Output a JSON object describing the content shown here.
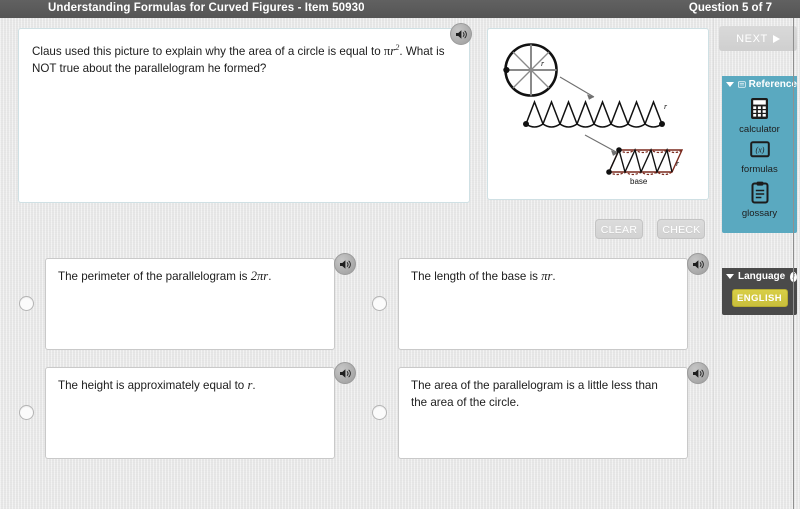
{
  "header": {
    "title": "Understanding Formulas for Curved Figures - Item 50930",
    "question_number": "Question 5 of 7"
  },
  "stem": {
    "text_before": "Claus used this picture to explain why the area of a circle is equal to ",
    "math_pi": "π",
    "math_r": "r",
    "math_exponent": "2",
    "text_after": ". What is NOT true about the parallelogram he formed?",
    "speaker_icon": "speaker-icon"
  },
  "figure": {
    "label_r_circle": "r",
    "label_r_strip": "r",
    "label_r_parallelogram": "r",
    "label_base": "base",
    "sector_count": 8,
    "outline_color": "#111111",
    "parallelogram_color": "#7a2a1e"
  },
  "actions": {
    "clear_label": "CLEAR",
    "check_label": "CHECK"
  },
  "options": [
    {
      "id": "option-a",
      "segments": [
        {
          "type": "text",
          "value": "The perimeter of the parallelogram is "
        },
        {
          "type": "math",
          "value": "2πr"
        },
        {
          "type": "text",
          "value": "."
        }
      ],
      "plain": "The perimeter of the parallelogram is 2πr.",
      "selected": false,
      "speaker_icon": "speaker-icon"
    },
    {
      "id": "option-b",
      "segments": [
        {
          "type": "text",
          "value": "The length of the base is "
        },
        {
          "type": "math",
          "value": "πr"
        },
        {
          "type": "text",
          "value": "."
        }
      ],
      "plain": "The length of the base is πr.",
      "selected": false,
      "speaker_icon": "speaker-icon"
    },
    {
      "id": "option-c",
      "segments": [
        {
          "type": "text",
          "value": "The height is approximately equal to "
        },
        {
          "type": "math",
          "value": "r"
        },
        {
          "type": "text",
          "value": "."
        }
      ],
      "plain": "The height is approximately equal to r.",
      "selected": false,
      "speaker_icon": "speaker-icon"
    },
    {
      "id": "option-d",
      "segments": [
        {
          "type": "text",
          "value": "The area of the parallelogram is a little less than the area of the circle."
        }
      ],
      "plain": "The area of the parallelogram is a little less than the area of the circle.",
      "selected": false,
      "speaker_icon": "speaker-icon"
    }
  ],
  "rail": {
    "next_label": "NEXT",
    "next_icon": "play-triangle-icon",
    "reference": {
      "title": "Reference",
      "caret_icon": "caret-down-icon",
      "header_icon": "book-icon",
      "items": [
        {
          "label": "calculator",
          "icon": "calculator-icon"
        },
        {
          "label": "formulas",
          "icon": "formulas-icon"
        },
        {
          "label": "glossary",
          "icon": "clipboard-icon"
        }
      ]
    },
    "language": {
      "title": "Language",
      "caret_icon": "caret-down-icon",
      "info_icon": "info-icon",
      "info_char": "i",
      "selected": "ENGLISH"
    }
  },
  "colors": {
    "header_bg": "#585858",
    "reference_panel": "#5aa9c0",
    "language_panel": "#4a4a4a",
    "language_button": "#cfc540",
    "page_bg": "#e7e7e7"
  }
}
